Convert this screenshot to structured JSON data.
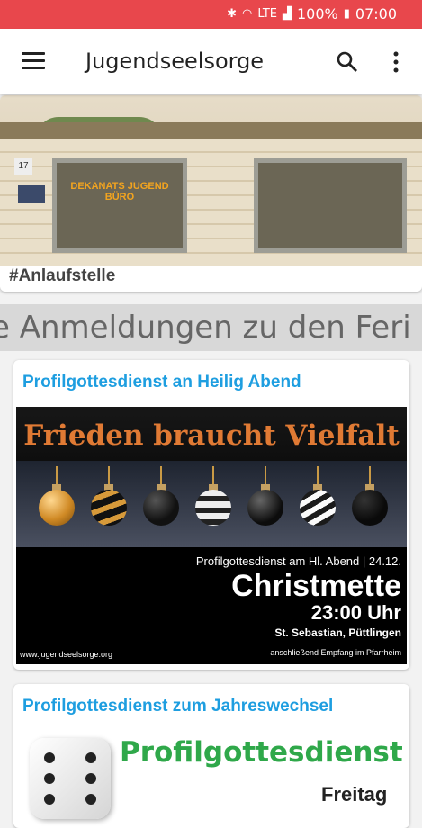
{
  "status_bar": {
    "battery": "100%",
    "time": "07:00",
    "lte": "LTE"
  },
  "app_bar": {
    "title": "Jugendseelsorge"
  },
  "hero": {
    "caption": "#Anlaufstelle",
    "sign_text": "DEKANATS JUGEND BÜRO"
  },
  "ticker": {
    "text": "e Anmeldungen zu den Feri"
  },
  "events": [
    {
      "title": "Profilgottesdienst an Heilig Abend",
      "poster": {
        "headline": "Frieden braucht Vielfalt",
        "subline": "Profilgottesdienst am Hl. Abend | 24.12.",
        "name": "Christmette",
        "time": "23:00 Uhr",
        "location": "St. Sebastian, Püttlingen",
        "website": "www.jugendseelsorge.org",
        "footer": "anschließend Empfang im Pfarrheim"
      }
    },
    {
      "title": "Profilgottesdienst zum Jahreswechsel",
      "poster": {
        "headline": "Profilgottesdienst",
        "day": "Freitag"
      }
    }
  ],
  "colors": {
    "status_bar": "#e8474c",
    "event_title": "#1e9ee0",
    "poster_headline": "#e07a34",
    "profil_green": "#2fa84a"
  }
}
